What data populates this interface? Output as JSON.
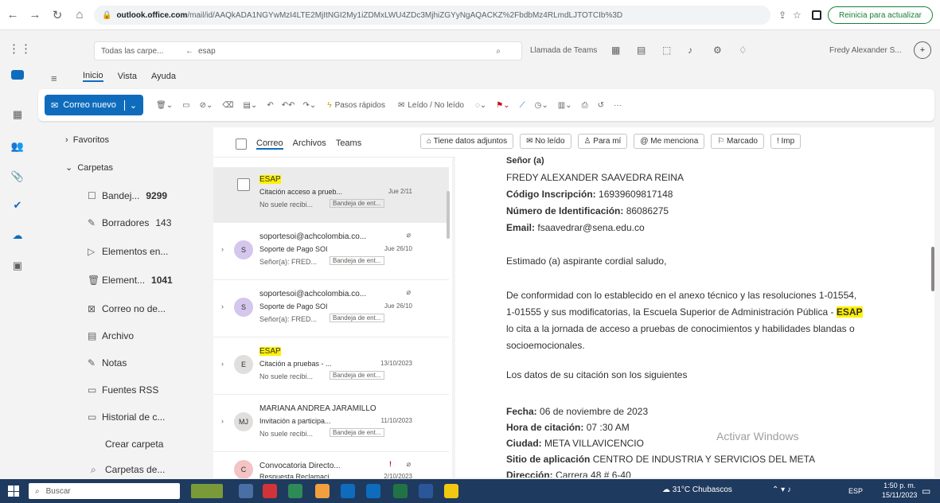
{
  "browser": {
    "address_host": "outlook.office.com",
    "address_rest": "/mail/id/AAQkADA1NGYwMzI4LTE2MjItNGI2My1iZDMxLWU4ZDc3MjhiZGYyNgAQACKZ%2FbdbMz4RLmdLJTOTCIb%3D",
    "update_label": "Reinicia para actualizar"
  },
  "header": {
    "folder_scope": "Todas las carpe...",
    "search_value": "esap",
    "teams_call": "Llamada de Teams",
    "user_name": "Fredy Alexander S..."
  },
  "ribbon": {
    "tabs": [
      "Inicio",
      "Vista",
      "Ayuda"
    ],
    "new_mail": "Correo nuevo",
    "quick_steps": "Pasos rápidos",
    "read_unread": "Leído / No leído"
  },
  "folders": {
    "favorites": "Favoritos",
    "folders_title": "Carpetas",
    "items": [
      {
        "icon": "inbox-icon",
        "label": "Bandej...",
        "count": "9299"
      },
      {
        "icon": "drafts-icon",
        "label": "Borradores",
        "count": "143"
      },
      {
        "icon": "sent-icon",
        "label": "Elementos en...",
        "count": ""
      },
      {
        "icon": "trash-icon",
        "label": "Element...",
        "count": "1041"
      },
      {
        "icon": "junk-icon",
        "label": "Correo no de...",
        "count": ""
      },
      {
        "icon": "archive-icon",
        "label": "Archivo",
        "count": ""
      },
      {
        "icon": "notes-icon",
        "label": "Notas",
        "count": ""
      },
      {
        "icon": "rss-icon",
        "label": "Fuentes RSS",
        "count": ""
      },
      {
        "icon": "history-icon",
        "label": "Historial de c...",
        "count": ""
      }
    ],
    "create_folder": "Crear carpeta",
    "search_folders": "Carpetas de..."
  },
  "list": {
    "tabs": [
      "Correo",
      "Archivos",
      "Teams"
    ],
    "messages": [
      {
        "avatar": "",
        "sender": "ESAP",
        "subject": "Citación acceso a prueb...",
        "date": "Jue 2/11",
        "preview": "No suele recibi...",
        "tag": "Bandeja de ent..."
      },
      {
        "avatar": "S",
        "sender": "soportesoi@achcolombia.co...",
        "subject": "Soporte de Pago SOI",
        "date": "Jue 26/10",
        "preview": "Señor(a): FRED...",
        "tag": "Bandeja de ent..."
      },
      {
        "avatar": "S",
        "sender": "soportesoi@achcolombia.co...",
        "subject": "Soporte de Pago SOI",
        "date": "Jue 26/10",
        "preview": "Señor(a): FRED...",
        "tag": "Bandeja de ent..."
      },
      {
        "avatar": "E",
        "sender": "ESAP",
        "subject": "Citación a pruebas - ...",
        "date": "13/10/2023",
        "preview": "No suele recibi...",
        "tag": "Bandeja de ent..."
      },
      {
        "avatar": "MJ",
        "sender": "MARIANA ANDREA JARAMILLO",
        "subject": "Invitación a participa...",
        "date": "11/10/2023",
        "preview": "No suele recibi...",
        "tag": "Bandeja de ent..."
      },
      {
        "avatar": "C",
        "sender": "Convocatoria Directo...",
        "subject": "Respuesta Reclamaci...",
        "date": "2/10/2023",
        "preview": "",
        "tag": ""
      }
    ]
  },
  "filters": [
    "Tiene datos adjuntos",
    "No leído",
    "Para mí",
    "Me menciona",
    "Marcado",
    "Imp"
  ],
  "email": {
    "salutation": "Señor (a)",
    "name": "FREDY ALEXANDER SAAVEDRA REINA",
    "code_label": "Código Inscripción:",
    "code_value": "16939609817148",
    "id_label": "Número de Identificación:",
    "id_value": "86086275",
    "email_label": "Email:",
    "email_value": "fsaavedrar@sena.edu.co",
    "greeting": "Estimado (a) aspirante cordial saludo,",
    "body1": "De conformidad con lo establecido en el anexo técnico y las resoluciones 1-01554,",
    "body2_pre": "1-01555 y sus modificatorias, la Escuela Superior de Administración Pública - ",
    "body2_hl": "ESAP",
    "body3": "lo cita a la jornada de acceso a pruebas de conocimientos y habilidades blandas o",
    "body4": "socioemocionales.",
    "intro_data": "Los datos de su citación son los siguientes",
    "fecha_label": "Fecha:",
    "fecha_value": "06 de noviembre de 2023",
    "hora_label": "Hora de citación:",
    "hora_value": "07 :30 AM",
    "ciudad_label": "Ciudad:",
    "ciudad_value": "META VILLAVICENCIO",
    "sitio_label": "Sitio de aplicación",
    "sitio_value": "CENTRO DE INDUSTRIA Y SERVICIOS DEL META",
    "dir_label": "Dirección:",
    "dir_value": "Carrera 48 # 6-40"
  },
  "watermark": "Activar Windows",
  "taskbar": {
    "search": "Buscar",
    "weather": "31°C Chubascos",
    "lang": "ESP",
    "time": "1:50 p. m.",
    "date": "15/11/2023"
  }
}
